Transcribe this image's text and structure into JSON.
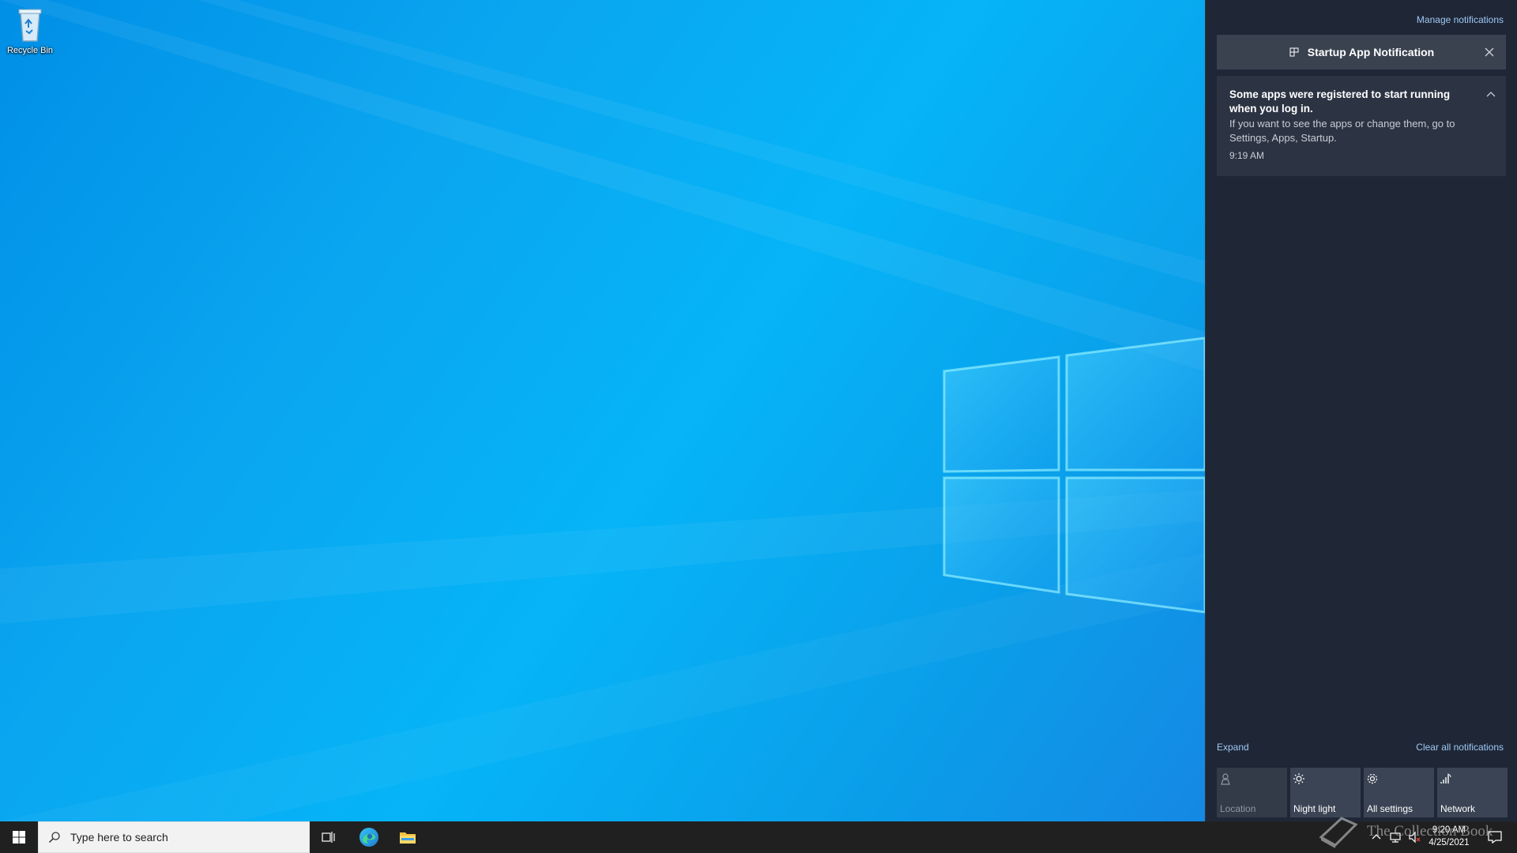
{
  "desktop": {
    "icons": [
      {
        "label": "Recycle Bin",
        "icon": "recycle-bin-icon"
      }
    ]
  },
  "action_center": {
    "manage_link": "Manage notifications",
    "notification": {
      "app_name": "Startup App Notification",
      "title": "Some apps were registered to start running when you log in.",
      "body": "If you want to see the apps or change them, go to Settings, Apps, Startup.",
      "time": "9:19 AM"
    },
    "expand_label": "Expand",
    "clear_all_label": "Clear all notifications",
    "quick_actions": [
      {
        "label": "Location",
        "icon": "location-icon",
        "enabled": false
      },
      {
        "label": "Night light",
        "icon": "brightness-icon",
        "enabled": true
      },
      {
        "label": "All settings",
        "icon": "gear-icon",
        "enabled": true
      },
      {
        "label": "Network",
        "icon": "network-icon",
        "enabled": true
      }
    ]
  },
  "taskbar": {
    "search_placeholder": "Type here to search",
    "pinned_apps": [
      "task-view-icon",
      "edge-icon",
      "file-explorer-icon"
    ],
    "clock": {
      "time": "9:20 AM",
      "date": "4/25/2021"
    },
    "watermark": "The Collection Book"
  },
  "colors": {
    "action_center_bg": "#1f2737",
    "taskbar_bg": "#202020",
    "link": "#9fc8f3",
    "accent": "#0078d7"
  }
}
